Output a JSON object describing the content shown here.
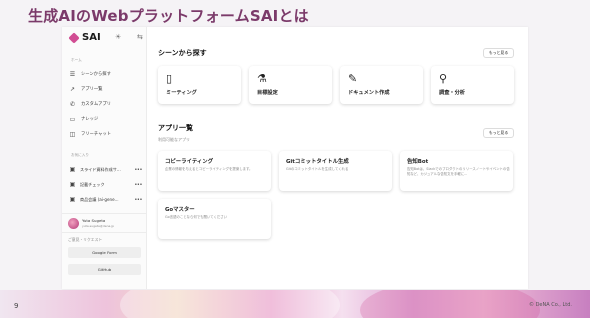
{
  "slide": {
    "title": "生成AIのWebプラットフォームSAIとは",
    "page_number": "9",
    "copyright": "© DeNA Co., Ltd."
  },
  "app": {
    "logo_text": "SAI",
    "sidebar": {
      "home_label": "ホーム",
      "nav_items": [
        {
          "label": "シーンから探す",
          "icon": "list-search-icon"
        },
        {
          "label": "アプリ一覧",
          "icon": "trend-icon"
        },
        {
          "label": "カスタムアプリ",
          "icon": "phone-icon"
        },
        {
          "label": "ナレッジ",
          "icon": "folder-icon"
        },
        {
          "label": "フリーチャット",
          "icon": "chat-icon"
        }
      ],
      "favorites_label": "お気に入り",
      "favorites": [
        {
          "label": "スライド資料作成サ..."
        },
        {
          "label": "記載チェック"
        },
        {
          "label": "商品会議 (ai-gene..."
        }
      ],
      "user": {
        "name": "Yuta Sugeta",
        "email": "yuta.sugeta@dena.jp"
      },
      "feedback_label": "ご意見・リクエスト",
      "buttons": [
        "Google Form",
        "GitHub"
      ]
    },
    "scenes": {
      "title": "シーンから探す",
      "more_label": "もっと見る",
      "cards": [
        {
          "label": "ミーティング",
          "icon": "door-icon"
        },
        {
          "label": "目標設定",
          "icon": "flask-icon"
        },
        {
          "label": "ドキュメント作成",
          "icon": "edit-document-icon"
        },
        {
          "label": "調査・分析",
          "icon": "beaker-icon"
        }
      ]
    },
    "apps": {
      "title": "アプリ一覧",
      "subtitle": "利用可能なアプリ",
      "more_label": "もっと見る",
      "cards": [
        {
          "title": "コピーライティング",
          "desc": "企業の情報を与えるとコピーライティングを提案します。"
        },
        {
          "title": "Gitコミットタイトル生成",
          "desc": "Gitのコミットタイトルを生成してくれる"
        },
        {
          "title": "告知Bot",
          "desc": "告知Botは、Slackでのプロダクトのリリースノートやイベントの告知など、カジュアルな告知文を手軽に..."
        },
        {
          "title": "Goマスター",
          "desc": "Go言語のことなら何でも聞いてください"
        }
      ]
    }
  }
}
